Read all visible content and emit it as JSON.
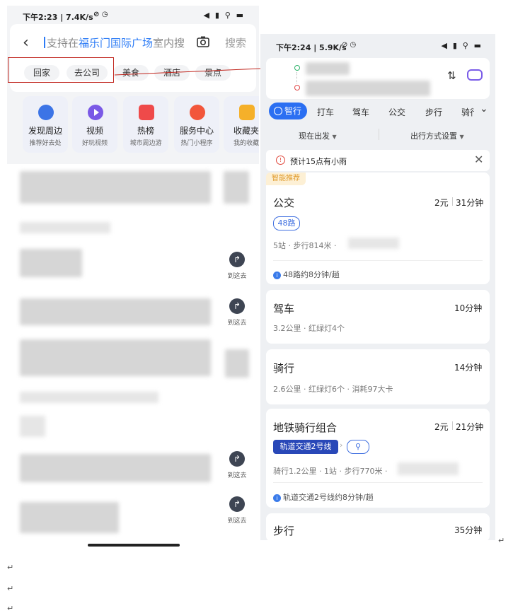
{
  "left_phone": {
    "status_time": "下午2:23 | 7.4K/s",
    "status_icons": "⊘ ◷",
    "status_right": "◀ ▮ ⚲ ▬",
    "search": {
      "prefix": "支持在",
      "highlight": "福乐门国际广场",
      "suffix": "室内搜",
      "button": "搜索"
    },
    "chips": [
      "回家",
      "去公司",
      "美食",
      "酒店",
      "景点"
    ],
    "quick_actions": [
      {
        "label": "发现周边",
        "sub": "推荐好去处",
        "color": "#3c74e6"
      },
      {
        "label": "视频",
        "sub": "好玩视频",
        "color": "#7a59e6"
      },
      {
        "label": "热榜",
        "sub": "城市周边游",
        "color": "#ef4a4a"
      },
      {
        "label": "服务中心",
        "sub": "热门小程序",
        "color": "#f2563b"
      },
      {
        "label": "收藏夹",
        "sub": "我的收藏",
        "color": "#f5b02a"
      }
    ],
    "goto_label": "到这去"
  },
  "right_phone": {
    "status_time": "下午2:24 | 5.9K/s",
    "status_icons": "⊘ ◷",
    "status_right": "◀ ▮ ⚲ ▬",
    "modes": [
      "智行",
      "打车",
      "驾车",
      "公交",
      "步行",
      "骑行"
    ],
    "depart": "现在出发",
    "settings": "出行方式设置",
    "weather": "预计15点有小雨",
    "recommend_badge": "智能推荐",
    "routes": {
      "bus": {
        "title": "公交",
        "price": "2元",
        "duration": "31分钟",
        "tag": "48路",
        "sub": "5站 · 步行814米 ·",
        "info": "48路约8分钟/趟"
      },
      "drive": {
        "title": "驾车",
        "duration": "10分钟",
        "sub": "3.2公里 · 红绿灯4个"
      },
      "bike": {
        "title": "骑行",
        "duration": "14分钟",
        "sub": "2.6公里 · 红绿灯6个 · 消耗97大卡"
      },
      "combo": {
        "title": "地铁骑行组合",
        "price": "2元",
        "duration": "21分钟",
        "tag": "轨道交通2号线",
        "sub": "骑行1.2公里 · 1站 · 步行770米 ·",
        "info": "轨道交通2号线约8分钟/趟"
      },
      "walk": {
        "title": "步行",
        "duration": "35分钟"
      }
    }
  },
  "doc_marks": [
    "↵",
    "↵",
    "↵",
    "↵"
  ],
  "colors": {
    "accent": "#2b6ff2",
    "annotation": "#c0241c"
  }
}
